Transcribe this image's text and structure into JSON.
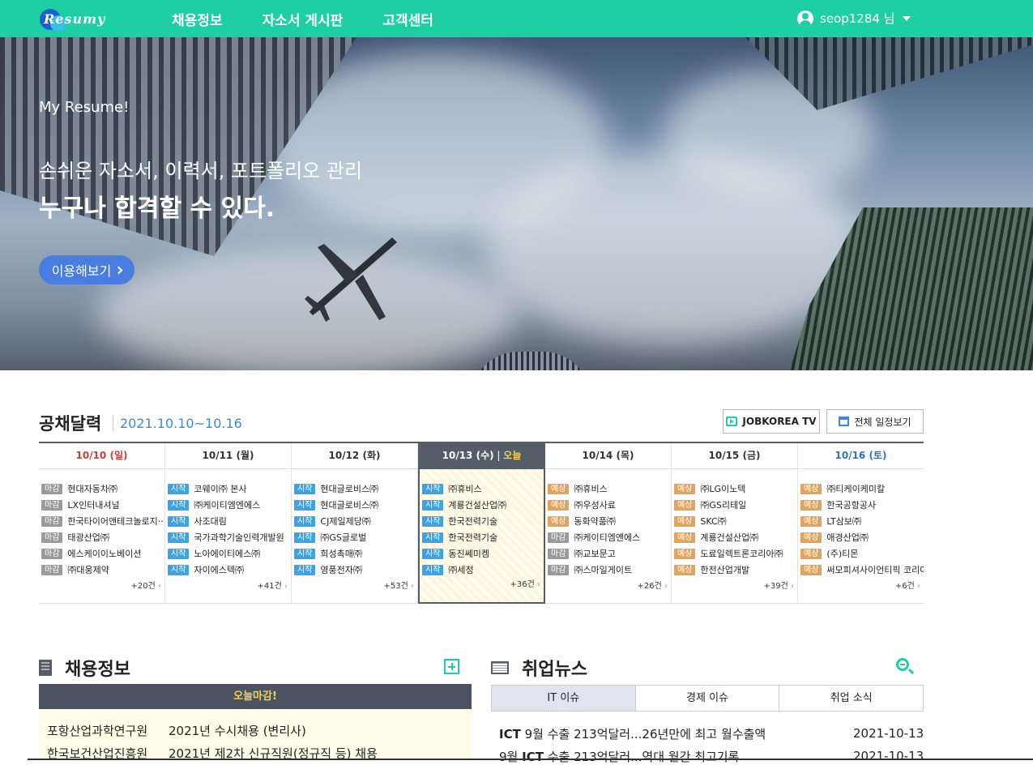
{
  "nav": {
    "logo_text": "Resumy",
    "menu": [
      "채용정보",
      "자소서 게시판",
      "고객센터"
    ],
    "user_label": "seop1284 님"
  },
  "hero": {
    "subtitle": "My Resume!",
    "line1": "손쉬운 자소서, 이력서, 포트폴리오 관리",
    "line2": "누구나 합격할 수 있다.",
    "button_label": "이용해보기"
  },
  "calendar": {
    "title": "공채달력",
    "range": "2021.10.10~10.16",
    "tv_button": "JOBKOREA TV",
    "all_button": "전체 일정보기",
    "days": [
      {
        "date": "10/10",
        "dow": "(일)",
        "kind": "sun",
        "more": "+20건",
        "entries": [
          [
            "마감",
            "end",
            "현대자동차㈜"
          ],
          [
            "마감",
            "end",
            "LX인터내셔널"
          ],
          [
            "마감",
            "end",
            "한국타이어앤테크놀로지··"
          ],
          [
            "마감",
            "end",
            "태광산업㈜"
          ],
          [
            "마감",
            "end",
            "에스케이이노베이션"
          ],
          [
            "마감",
            "end",
            "㈜대웅제약"
          ]
        ]
      },
      {
        "date": "10/11",
        "dow": "(월)",
        "kind": "",
        "more": "+41건",
        "entries": [
          [
            "시작",
            "start",
            "코웨이㈜ 본사"
          ],
          [
            "시작",
            "start",
            "㈜케이티엠엔에스"
          ],
          [
            "시작",
            "start",
            "사조대림"
          ],
          [
            "시작",
            "start",
            "국가과학기술인력개발원"
          ],
          [
            "시작",
            "start",
            "노아에이티에스㈜"
          ],
          [
            "시작",
            "start",
            "자이에스텍㈜"
          ]
        ]
      },
      {
        "date": "10/12",
        "dow": "(화)",
        "kind": "",
        "more": "+53건",
        "entries": [
          [
            "시작",
            "start",
            "현대글로비스㈜"
          ],
          [
            "시작",
            "start",
            "현대글로비스㈜"
          ],
          [
            "시작",
            "start",
            "CJ제일제당㈜"
          ],
          [
            "시작",
            "start",
            "㈜GS글로벌"
          ],
          [
            "시작",
            "start",
            "희성촉매㈜"
          ],
          [
            "시작",
            "start",
            "영풍전자㈜"
          ]
        ]
      },
      {
        "date": "10/13",
        "dow": "(수)",
        "kind": "today",
        "today_label": "오늘",
        "more": "+36건",
        "entries": [
          [
            "시작",
            "start",
            "㈜휴비스"
          ],
          [
            "시작",
            "start",
            "계룡건설산업㈜"
          ],
          [
            "시작",
            "start",
            "한국전력기술"
          ],
          [
            "시작",
            "start",
            "한국전력기술"
          ],
          [
            "시작",
            "start",
            "동진쎄미켐"
          ],
          [
            "시작",
            "start",
            "㈜세정"
          ]
        ]
      },
      {
        "date": "10/14",
        "dow": "(목)",
        "kind": "",
        "more": "+26건",
        "entries": [
          [
            "예상",
            "plan",
            "㈜휴비스"
          ],
          [
            "예상",
            "plan",
            "㈜우성사료"
          ],
          [
            "예상",
            "plan",
            "동화약품㈜"
          ],
          [
            "마감",
            "end",
            "㈜케이티엠엔에스"
          ],
          [
            "마감",
            "end",
            "㈜교보문고"
          ],
          [
            "마감",
            "end",
            "㈜스마일게이트"
          ]
        ]
      },
      {
        "date": "10/15",
        "dow": "(금)",
        "kind": "",
        "more": "+39건",
        "entries": [
          [
            "예상",
            "plan",
            "㈜LG이노텍"
          ],
          [
            "예상",
            "plan",
            "㈜GS리테일"
          ],
          [
            "예상",
            "plan",
            "SKC㈜"
          ],
          [
            "예상",
            "plan",
            "계룡건설산업㈜"
          ],
          [
            "예상",
            "plan",
            "도료일렉트론코리아㈜"
          ],
          [
            "예상",
            "plan",
            "한전산업개발"
          ]
        ]
      },
      {
        "date": "10/16",
        "dow": "(토)",
        "kind": "sat",
        "more": "+6건",
        "entries": [
          [
            "예상",
            "plan",
            "㈜티케이케미칼"
          ],
          [
            "예상",
            "plan",
            "한국공항공사"
          ],
          [
            "예상",
            "plan",
            "LT삼보㈜"
          ],
          [
            "예상",
            "plan",
            "애경산업㈜"
          ],
          [
            "예상",
            "plan",
            "(주)티몬"
          ],
          [
            "예상",
            "plan",
            "써모피셔사이언티픽 코리아"
          ]
        ]
      }
    ]
  },
  "jobs": {
    "title": "채용정보",
    "deadline_label": "오늘마감!",
    "items": [
      {
        "company": "포항산업과학연구원",
        "title": "2021년 수시채용 (변리사)"
      },
      {
        "company": "한국보건산업진흥원",
        "title": "2021년 제2차 신규직원(정규직 등) 채용"
      }
    ]
  },
  "news": {
    "title": "취업뉴스",
    "tabs": [
      "IT 이슈",
      "경제 이슈",
      "취업 소식"
    ],
    "items": [
      {
        "bold": "ICT",
        "text": " 9월 수출 213억달러...26년만에 최고 월수출액",
        "date": "2021-10-13"
      },
      {
        "pre": "9월 ",
        "bold": "ICT",
        "text": " 수출 213억달러...역대 월간 최고기록",
        "date": "2021-10-13"
      }
    ]
  }
}
